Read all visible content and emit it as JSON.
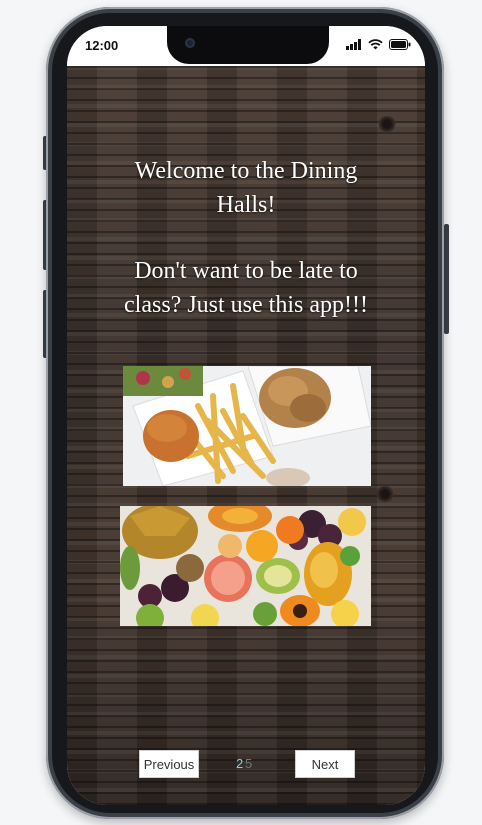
{
  "status_bar": {
    "time": "12:00",
    "icons": [
      "signal-icon",
      "wifi-icon",
      "battery-icon"
    ]
  },
  "main": {
    "welcome_line1": "Welcome to the Dining",
    "welcome_line2": "Halls!",
    "tagline_line1": "Don't want to be late to",
    "tagline_line2": "class? Just use this app!!!",
    "images": [
      "burger-fries-chicken-photo",
      "tropical-fruit-photo"
    ]
  },
  "pagination": {
    "previous_label": "Previous",
    "current_page": "2",
    "total_pages": "5",
    "next_label": "Next"
  },
  "colors": {
    "wood": "#3f332d",
    "button_bg": "#ffffff",
    "current_page_color": "#6fd6e8"
  }
}
